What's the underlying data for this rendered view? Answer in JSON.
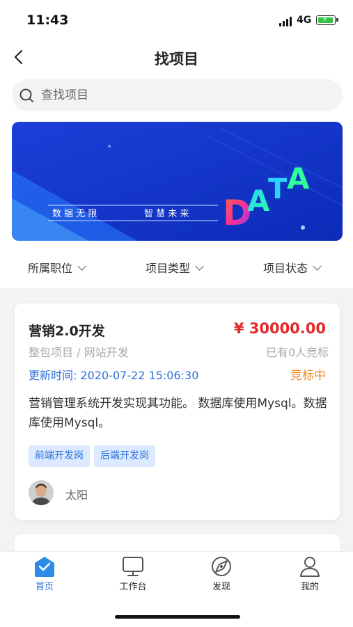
{
  "status_bar": {
    "time": "11:43",
    "network": "4G"
  },
  "nav": {
    "title": "找项目"
  },
  "search": {
    "placeholder": "查找项目"
  },
  "banner": {
    "tagline_left": "数 据 无 限",
    "tagline_right": "智 慧 未 来",
    "word": "DATA"
  },
  "filters": [
    {
      "label": "所属职位"
    },
    {
      "label": "项目类型"
    },
    {
      "label": "项目状态"
    }
  ],
  "project": {
    "title": "营销2.0开发",
    "price": "¥ 30000.00",
    "type": "整包项目 / 网站开发",
    "bid_count": "已有0人竞标",
    "update_time": "更新时间: 2020-07-22 15:06:30",
    "status": "竞标中",
    "status_color": "#f08a24",
    "description": "营销管理系统开发实现其功能。 数据库使用Mysql。数据库使用Mysql。",
    "tags": [
      "前端开发岗",
      "后端开发岗"
    ],
    "owner": "太阳"
  },
  "tabbar": [
    {
      "label": "首页",
      "icon": "home-icon",
      "active": true
    },
    {
      "label": "工作台",
      "icon": "monitor-icon",
      "active": false
    },
    {
      "label": "发现",
      "icon": "compass-icon",
      "active": false
    },
    {
      "label": "我的",
      "icon": "user-icon",
      "active": false
    }
  ],
  "colors": {
    "accent": "#2a6fdb",
    "price": "#e02a2a",
    "tag_bg": "#dceaff"
  }
}
